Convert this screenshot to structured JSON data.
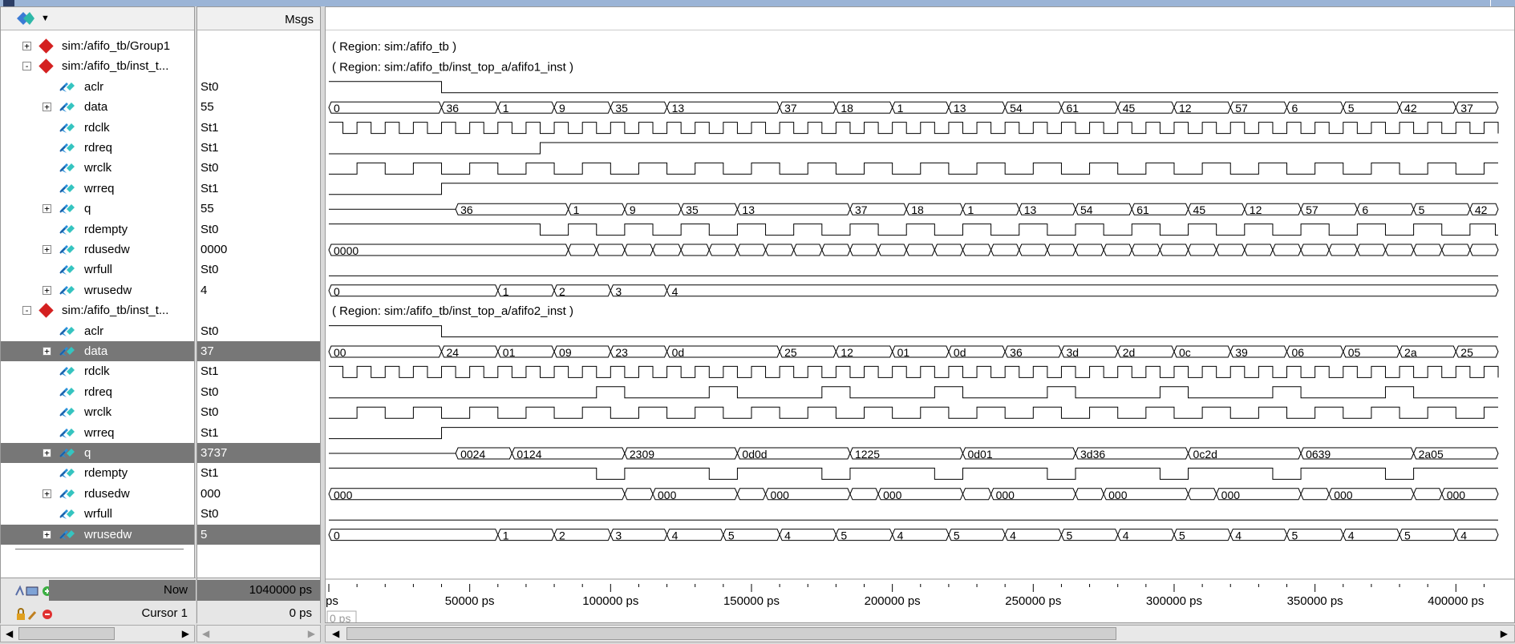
{
  "header": {
    "msgs_label": "Msgs"
  },
  "rows": [
    {
      "name": "sim:/afifo_tb/Group1",
      "value": "",
      "type": "group",
      "expand": "+",
      "indent": 0
    },
    {
      "name": "sim:/afifo_tb/inst_t...",
      "value": "",
      "type": "group",
      "expand": "-",
      "indent": 0
    },
    {
      "name": "aclr",
      "value": "St0",
      "type": "bit",
      "indent": 1
    },
    {
      "name": "data",
      "value": "55",
      "type": "bus",
      "expand": "+",
      "indent": 1
    },
    {
      "name": "rdclk",
      "value": "St1",
      "type": "bit",
      "indent": 1
    },
    {
      "name": "rdreq",
      "value": "St1",
      "type": "bit",
      "indent": 1
    },
    {
      "name": "wrclk",
      "value": "St0",
      "type": "bit",
      "indent": 1
    },
    {
      "name": "wrreq",
      "value": "St1",
      "type": "bit",
      "indent": 1
    },
    {
      "name": "q",
      "value": "55",
      "type": "bus",
      "expand": "+",
      "indent": 1
    },
    {
      "name": "rdempty",
      "value": "St0",
      "type": "bit",
      "indent": 1
    },
    {
      "name": "rdusedw",
      "value": "0000",
      "type": "bus",
      "expand": "+",
      "indent": 1
    },
    {
      "name": "wrfull",
      "value": "St0",
      "type": "bit",
      "indent": 1
    },
    {
      "name": "wrusedw",
      "value": "4",
      "type": "bus",
      "expand": "+",
      "indent": 1
    },
    {
      "name": "sim:/afifo_tb/inst_t...",
      "value": "",
      "type": "group",
      "expand": "-",
      "indent": 0
    },
    {
      "name": "aclr",
      "value": "St0",
      "type": "bit",
      "indent": 1
    },
    {
      "name": "data",
      "value": "37",
      "type": "bus",
      "expand": "+",
      "indent": 1,
      "selected": true
    },
    {
      "name": "rdclk",
      "value": "St1",
      "type": "bit",
      "indent": 1
    },
    {
      "name": "rdreq",
      "value": "St0",
      "type": "bit",
      "indent": 1
    },
    {
      "name": "wrclk",
      "value": "St0",
      "type": "bit",
      "indent": 1
    },
    {
      "name": "wrreq",
      "value": "St1",
      "type": "bit",
      "indent": 1
    },
    {
      "name": "q",
      "value": "3737",
      "type": "bus",
      "expand": "+",
      "indent": 1,
      "selected": true
    },
    {
      "name": "rdempty",
      "value": "St1",
      "type": "bit",
      "indent": 1
    },
    {
      "name": "rdusedw",
      "value": "000",
      "type": "bus",
      "expand": "+",
      "indent": 1
    },
    {
      "name": "wrfull",
      "value": "St0",
      "type": "bit",
      "indent": 1
    },
    {
      "name": "wrusedw",
      "value": "5",
      "type": "bus",
      "expand": "+",
      "indent": 1,
      "selected": true
    }
  ],
  "regions": [
    {
      "row": 0,
      "text": "( Region: sim:/afifo_tb )"
    },
    {
      "row": 1,
      "text": "( Region: sim:/afifo_tb/inst_top_a/afifo1_inst )"
    },
    {
      "row": 13,
      "text": "( Region: sim:/afifo_tb/inst_top_a/afifo2_inst )"
    }
  ],
  "waves": {
    "t_start_ps": 0,
    "t_end_ps": 415000,
    "signals": [
      {
        "row": 2,
        "kind": "bit",
        "transitions": [
          [
            0,
            1
          ],
          [
            40000,
            0
          ]
        ]
      },
      {
        "row": 3,
        "kind": "bus",
        "values": [
          [
            0,
            "0"
          ],
          [
            40000,
            "36"
          ],
          [
            60000,
            "1"
          ],
          [
            80000,
            "9"
          ],
          [
            100000,
            "35"
          ],
          [
            120000,
            "13"
          ],
          [
            160000,
            "37"
          ],
          [
            180000,
            "18"
          ],
          [
            200000,
            "1"
          ],
          [
            220000,
            "13"
          ],
          [
            240000,
            "54"
          ],
          [
            260000,
            "61"
          ],
          [
            280000,
            "45"
          ],
          [
            300000,
            "12"
          ],
          [
            320000,
            "57"
          ],
          [
            340000,
            "6"
          ],
          [
            360000,
            "5"
          ],
          [
            380000,
            "42"
          ],
          [
            400000,
            "37"
          ]
        ]
      },
      {
        "row": 4,
        "kind": "clock",
        "period": 10000,
        "phase": 0,
        "first": 1
      },
      {
        "row": 5,
        "kind": "bit",
        "transitions": [
          [
            0,
            0
          ],
          [
            75000,
            1
          ]
        ]
      },
      {
        "row": 6,
        "kind": "clock",
        "period": 20000,
        "phase": 0,
        "first": 0
      },
      {
        "row": 7,
        "kind": "bit",
        "transitions": [
          [
            0,
            0
          ],
          [
            40000,
            1
          ]
        ]
      },
      {
        "row": 8,
        "kind": "bus",
        "values": [
          [
            0,
            ""
          ],
          [
            45000,
            "36"
          ],
          [
            85000,
            "1"
          ],
          [
            105000,
            "9"
          ],
          [
            125000,
            "35"
          ],
          [
            145000,
            "13"
          ],
          [
            185000,
            "37"
          ],
          [
            205000,
            "18"
          ],
          [
            225000,
            "1"
          ],
          [
            245000,
            "13"
          ],
          [
            265000,
            "54"
          ],
          [
            285000,
            "61"
          ],
          [
            305000,
            "45"
          ],
          [
            325000,
            "12"
          ],
          [
            345000,
            "57"
          ],
          [
            365000,
            "6"
          ],
          [
            385000,
            "5"
          ],
          [
            405000,
            "42"
          ]
        ]
      },
      {
        "row": 9,
        "kind": "bit",
        "transitions": [
          [
            0,
            1
          ],
          [
            75000,
            0
          ],
          [
            85000,
            1
          ],
          [
            95000,
            0
          ],
          [
            105000,
            1
          ],
          [
            115000,
            0
          ],
          [
            125000,
            1
          ],
          [
            135000,
            0
          ],
          [
            145000,
            1
          ],
          [
            155000,
            0
          ],
          [
            165000,
            1
          ],
          [
            175000,
            0
          ],
          [
            185000,
            1
          ],
          [
            195000,
            0
          ],
          [
            205000,
            1
          ],
          [
            215000,
            0
          ],
          [
            225000,
            1
          ],
          [
            235000,
            0
          ],
          [
            245000,
            1
          ],
          [
            255000,
            0
          ],
          [
            265000,
            1
          ],
          [
            275000,
            0
          ],
          [
            285000,
            1
          ],
          [
            295000,
            0
          ],
          [
            305000,
            1
          ],
          [
            315000,
            0
          ],
          [
            325000,
            1
          ],
          [
            335000,
            0
          ],
          [
            345000,
            1
          ],
          [
            355000,
            0
          ],
          [
            365000,
            1
          ],
          [
            375000,
            0
          ],
          [
            385000,
            1
          ],
          [
            395000,
            0
          ],
          [
            405000,
            1
          ],
          [
            414000,
            0
          ]
        ]
      },
      {
        "row": 10,
        "kind": "bus",
        "values": [
          [
            0,
            "0000"
          ],
          [
            85000,
            ""
          ],
          [
            95000,
            ""
          ],
          [
            105000,
            ""
          ],
          [
            115000,
            ""
          ],
          [
            125000,
            ""
          ],
          [
            135000,
            ""
          ],
          [
            145000,
            ""
          ],
          [
            155000,
            ""
          ],
          [
            165000,
            ""
          ],
          [
            175000,
            ""
          ],
          [
            185000,
            ""
          ],
          [
            195000,
            ""
          ],
          [
            205000,
            ""
          ],
          [
            215000,
            ""
          ],
          [
            225000,
            ""
          ],
          [
            235000,
            ""
          ],
          [
            245000,
            ""
          ],
          [
            255000,
            ""
          ],
          [
            265000,
            ""
          ],
          [
            275000,
            ""
          ],
          [
            285000,
            ""
          ],
          [
            295000,
            ""
          ],
          [
            305000,
            ""
          ],
          [
            315000,
            ""
          ],
          [
            325000,
            ""
          ],
          [
            335000,
            ""
          ],
          [
            345000,
            ""
          ],
          [
            355000,
            ""
          ],
          [
            365000,
            ""
          ],
          [
            375000,
            ""
          ],
          [
            385000,
            ""
          ],
          [
            395000,
            ""
          ],
          [
            405000,
            ""
          ]
        ]
      },
      {
        "row": 11,
        "kind": "bit",
        "transitions": [
          [
            0,
            0
          ]
        ]
      },
      {
        "row": 12,
        "kind": "bus",
        "values": [
          [
            0,
            "0"
          ],
          [
            60000,
            "1"
          ],
          [
            80000,
            "2"
          ],
          [
            100000,
            "3"
          ],
          [
            120000,
            "4"
          ]
        ]
      },
      {
        "row": 14,
        "kind": "bit",
        "transitions": [
          [
            0,
            1
          ],
          [
            40000,
            0
          ]
        ]
      },
      {
        "row": 15,
        "kind": "bus",
        "values": [
          [
            0,
            "00"
          ],
          [
            40000,
            "24"
          ],
          [
            60000,
            "01"
          ],
          [
            80000,
            "09"
          ],
          [
            100000,
            "23"
          ],
          [
            120000,
            "0d"
          ],
          [
            160000,
            "25"
          ],
          [
            180000,
            "12"
          ],
          [
            200000,
            "01"
          ],
          [
            220000,
            "0d"
          ],
          [
            240000,
            "36"
          ],
          [
            260000,
            "3d"
          ],
          [
            280000,
            "2d"
          ],
          [
            300000,
            "0c"
          ],
          [
            320000,
            "39"
          ],
          [
            340000,
            "06"
          ],
          [
            360000,
            "05"
          ],
          [
            380000,
            "2a"
          ],
          [
            400000,
            "25"
          ]
        ]
      },
      {
        "row": 16,
        "kind": "clock",
        "period": 10000,
        "phase": 0,
        "first": 1
      },
      {
        "row": 17,
        "kind": "bit",
        "transitions": [
          [
            0,
            0
          ],
          [
            95000,
            1
          ],
          [
            105000,
            0
          ],
          [
            135000,
            1
          ],
          [
            145000,
            0
          ],
          [
            175000,
            1
          ],
          [
            185000,
            0
          ],
          [
            215000,
            1
          ],
          [
            225000,
            0
          ],
          [
            255000,
            1
          ],
          [
            265000,
            0
          ],
          [
            295000,
            1
          ],
          [
            305000,
            0
          ],
          [
            335000,
            1
          ],
          [
            345000,
            0
          ],
          [
            375000,
            1
          ],
          [
            385000,
            0
          ]
        ]
      },
      {
        "row": 18,
        "kind": "clock",
        "period": 20000,
        "phase": 0,
        "first": 0
      },
      {
        "row": 19,
        "kind": "bit",
        "transitions": [
          [
            0,
            0
          ],
          [
            40000,
            1
          ]
        ]
      },
      {
        "row": 20,
        "kind": "bus",
        "values": [
          [
            0,
            ""
          ],
          [
            45000,
            "0024"
          ],
          [
            65000,
            "0124"
          ],
          [
            105000,
            "2309"
          ],
          [
            145000,
            "0d0d"
          ],
          [
            185000,
            "1225"
          ],
          [
            225000,
            "0d01"
          ],
          [
            265000,
            "3d36"
          ],
          [
            305000,
            "0c2d"
          ],
          [
            345000,
            "0639"
          ],
          [
            385000,
            "2a05"
          ]
        ]
      },
      {
        "row": 21,
        "kind": "bit",
        "transitions": [
          [
            0,
            1
          ],
          [
            95000,
            0
          ],
          [
            105000,
            1
          ],
          [
            135000,
            0
          ],
          [
            145000,
            1
          ],
          [
            175000,
            0
          ],
          [
            185000,
            1
          ],
          [
            215000,
            0
          ],
          [
            225000,
            1
          ],
          [
            255000,
            0
          ],
          [
            265000,
            1
          ],
          [
            295000,
            0
          ],
          [
            305000,
            1
          ],
          [
            335000,
            0
          ],
          [
            345000,
            1
          ],
          [
            375000,
            0
          ],
          [
            385000,
            1
          ]
        ]
      },
      {
        "row": 22,
        "kind": "bus",
        "values": [
          [
            0,
            "000"
          ],
          [
            105000,
            ""
          ],
          [
            115000,
            "000"
          ],
          [
            145000,
            ""
          ],
          [
            155000,
            "000"
          ],
          [
            185000,
            ""
          ],
          [
            195000,
            "000"
          ],
          [
            225000,
            ""
          ],
          [
            235000,
            "000"
          ],
          [
            265000,
            ""
          ],
          [
            275000,
            "000"
          ],
          [
            305000,
            ""
          ],
          [
            315000,
            "000"
          ],
          [
            345000,
            ""
          ],
          [
            355000,
            "000"
          ],
          [
            385000,
            ""
          ],
          [
            395000,
            "000"
          ]
        ]
      },
      {
        "row": 23,
        "kind": "bit",
        "transitions": [
          [
            0,
            0
          ]
        ]
      },
      {
        "row": 24,
        "kind": "bus",
        "values": [
          [
            0,
            "0"
          ],
          [
            60000,
            "1"
          ],
          [
            80000,
            "2"
          ],
          [
            100000,
            "3"
          ],
          [
            120000,
            "4"
          ],
          [
            140000,
            "5"
          ],
          [
            160000,
            "4"
          ],
          [
            180000,
            "5"
          ],
          [
            200000,
            "4"
          ],
          [
            220000,
            "5"
          ],
          [
            240000,
            "4"
          ],
          [
            260000,
            "5"
          ],
          [
            280000,
            "4"
          ],
          [
            300000,
            "5"
          ],
          [
            320000,
            "4"
          ],
          [
            340000,
            "5"
          ],
          [
            360000,
            "4"
          ],
          [
            380000,
            "5"
          ],
          [
            400000,
            "4"
          ]
        ]
      }
    ]
  },
  "timeline": {
    "first_label": "ps",
    "labels": [
      "50000 ps",
      "100000 ps",
      "150000 ps",
      "200000 ps",
      "250000 ps",
      "300000 ps",
      "350000 ps",
      "400000 ps"
    ],
    "cursor_readout": "0 ps"
  },
  "status": {
    "now_label": "Now",
    "now_value": "1040000 ps",
    "cursor_label": "Cursor 1",
    "cursor_value": "0 ps"
  },
  "colors": {
    "wave": "#000000",
    "selected_row": "#777777",
    "background": "#ffffff"
  }
}
